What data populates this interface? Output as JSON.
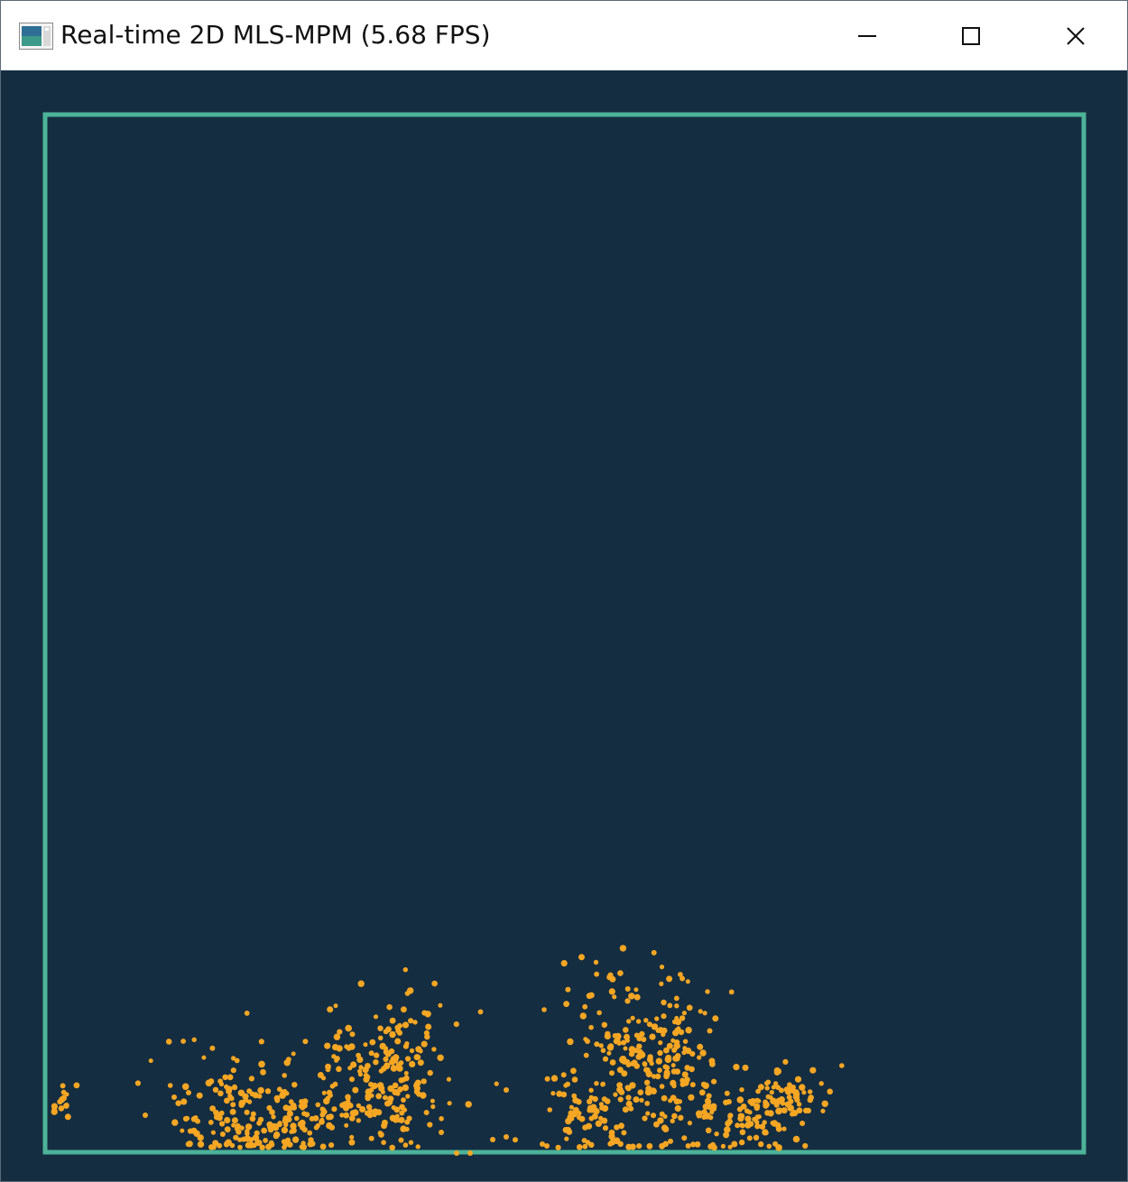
{
  "window": {
    "title": "Real-time 2D MLS-MPM (5.68 FPS)",
    "icon": "app-window-icon",
    "controls": [
      "minimize-icon",
      "maximize-icon",
      "close-icon"
    ]
  },
  "simulation": {
    "background_color": "#142d41",
    "boundary_color": "#4cb399",
    "particle_color": "#f5a623"
  }
}
